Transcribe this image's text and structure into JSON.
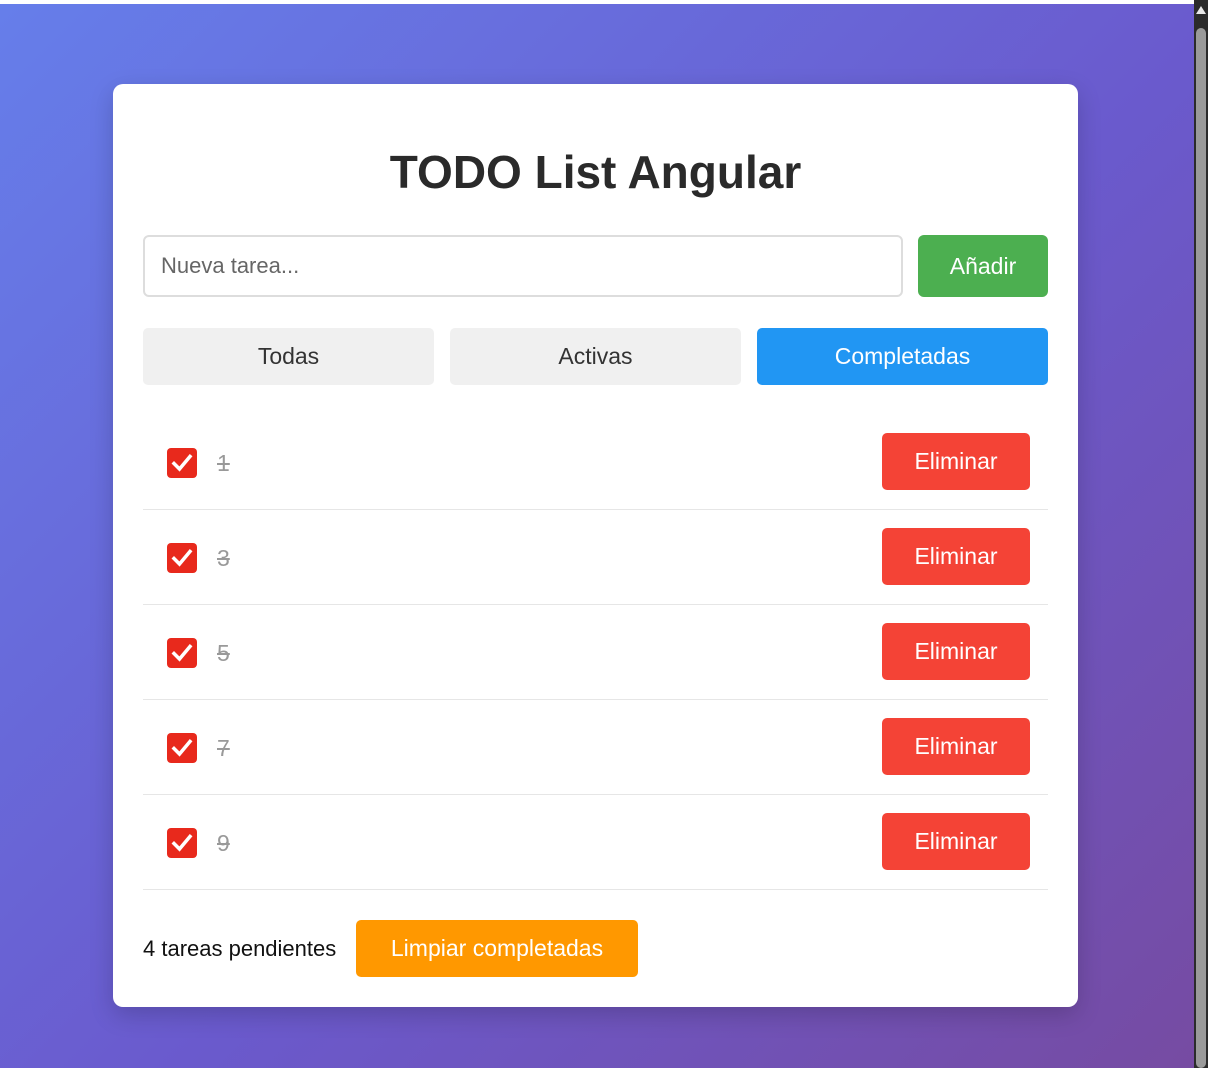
{
  "app": {
    "title": "TODO List Angular"
  },
  "add_form": {
    "placeholder": "Nueva tarea...",
    "value": "",
    "button_label": "Añadir"
  },
  "filters": [
    {
      "label": "Todas",
      "active": false
    },
    {
      "label": "Activas",
      "active": false
    },
    {
      "label": "Completadas",
      "active": true
    }
  ],
  "todos": [
    {
      "text": "1",
      "completed": true,
      "delete_label": "Eliminar"
    },
    {
      "text": "3",
      "completed": true,
      "delete_label": "Eliminar"
    },
    {
      "text": "5",
      "completed": true,
      "delete_label": "Eliminar"
    },
    {
      "text": "7",
      "completed": true,
      "delete_label": "Eliminar"
    },
    {
      "text": "9",
      "completed": true,
      "delete_label": "Eliminar"
    }
  ],
  "footer": {
    "pending_text": "4 tareas pendientes",
    "clear_label": "Limpiar completadas"
  },
  "colors": {
    "add_button": "#4caf50",
    "active_filter": "#2196f3",
    "delete_button": "#f44336",
    "clear_button": "#ff9800",
    "checkbox": "#e8291c"
  }
}
